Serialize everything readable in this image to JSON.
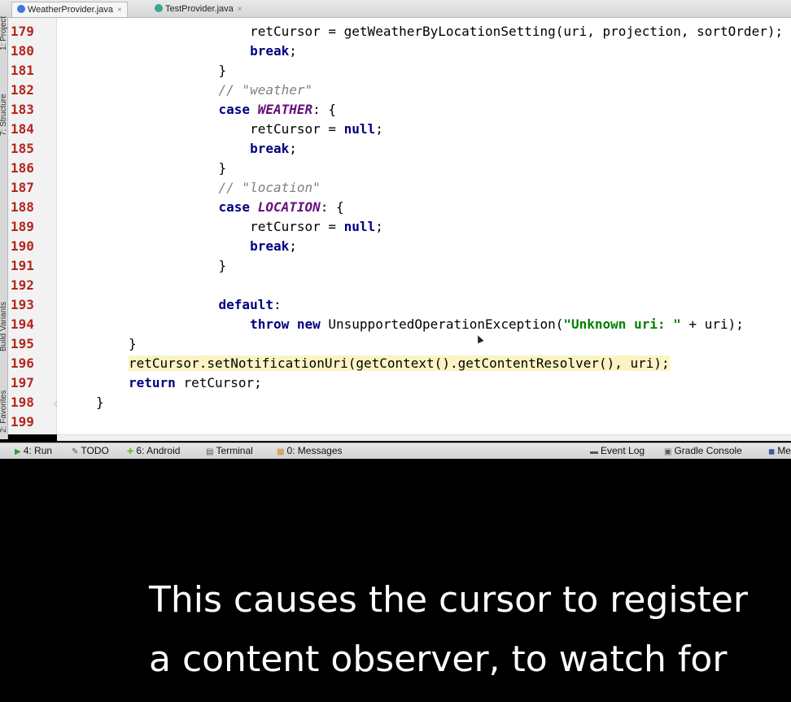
{
  "tabs": [
    {
      "label": "WeatherProvider.java",
      "close": "×",
      "color": "#3d7bd9"
    },
    {
      "label": "TestProvider.java",
      "close": "×",
      "color": "#3aa58f"
    }
  ],
  "left_strip": {
    "project": "1: Project",
    "structure": "7: Structure",
    "build_variants": "Build Variants",
    "favorites": "2: Favorites"
  },
  "editor": {
    "lines": [
      {
        "n": "179",
        "t": [
          {
            "c": "",
            "x": "        retCursor = getWeatherByLocationSetting(uri, projection, sortOrder);"
          }
        ]
      },
      {
        "n": "180",
        "t": [
          {
            "c": "",
            "x": "        "
          },
          {
            "c": "kw",
            "x": "break"
          },
          {
            "c": "",
            "x": ";"
          }
        ]
      },
      {
        "n": "181",
        "t": [
          {
            "c": "",
            "x": "    }"
          }
        ]
      },
      {
        "n": "182",
        "t": [
          {
            "c": "",
            "x": "    "
          },
          {
            "c": "cm",
            "x": "// \"weather\""
          }
        ]
      },
      {
        "n": "183",
        "t": [
          {
            "c": "",
            "x": "    "
          },
          {
            "c": "kw",
            "x": "case "
          },
          {
            "c": "const",
            "x": "WEATHER"
          },
          {
            "c": "",
            "x": ": {"
          }
        ]
      },
      {
        "n": "184",
        "t": [
          {
            "c": "",
            "x": "        retCursor = "
          },
          {
            "c": "kw",
            "x": "null"
          },
          {
            "c": "",
            "x": ";"
          }
        ]
      },
      {
        "n": "185",
        "t": [
          {
            "c": "",
            "x": "        "
          },
          {
            "c": "kw",
            "x": "break"
          },
          {
            "c": "",
            "x": ";"
          }
        ]
      },
      {
        "n": "186",
        "t": [
          {
            "c": "",
            "x": "    }"
          }
        ]
      },
      {
        "n": "187",
        "t": [
          {
            "c": "",
            "x": "    "
          },
          {
            "c": "cm",
            "x": "// \"location\""
          }
        ]
      },
      {
        "n": "188",
        "t": [
          {
            "c": "",
            "x": "    "
          },
          {
            "c": "kw",
            "x": "case "
          },
          {
            "c": "const",
            "x": "LOCATION"
          },
          {
            "c": "",
            "x": ": {"
          }
        ]
      },
      {
        "n": "189",
        "t": [
          {
            "c": "",
            "x": "        retCursor = "
          },
          {
            "c": "kw",
            "x": "null"
          },
          {
            "c": "",
            "x": ";"
          }
        ]
      },
      {
        "n": "190",
        "t": [
          {
            "c": "",
            "x": "        "
          },
          {
            "c": "kw",
            "x": "break"
          },
          {
            "c": "",
            "x": ";"
          }
        ]
      },
      {
        "n": "191",
        "t": [
          {
            "c": "",
            "x": "    }"
          }
        ]
      },
      {
        "n": "192",
        "t": [
          {
            "c": "",
            "x": ""
          }
        ]
      },
      {
        "n": "193",
        "t": [
          {
            "c": "",
            "x": "    "
          },
          {
            "c": "kw",
            "x": "default"
          },
          {
            "c": "",
            "x": ":"
          }
        ]
      },
      {
        "n": "194",
        "t": [
          {
            "c": "",
            "x": "        "
          },
          {
            "c": "kw",
            "x": "throw new "
          },
          {
            "c": "",
            "x": "UnsupportedOperationException("
          },
          {
            "c": "str",
            "x": "\"Unknown uri: \""
          },
          {
            "c": "",
            "x": " + uri);"
          }
        ]
      },
      {
        "n": "195",
        "t": [
          {
            "c": "",
            "x": "}"
          }
        ]
      },
      {
        "n": "196",
        "t": [
          {
            "c": "hl",
            "x": "retCursor.setNotificationUri(getContext().getContentResolver(), uri);"
          }
        ]
      },
      {
        "n": "197",
        "t": [
          {
            "c": "kw",
            "x": "return "
          },
          {
            "c": "",
            "x": "retCursor;"
          }
        ]
      },
      {
        "n": "198",
        "t": [
          {
            "c": "",
            "x": "}"
          }
        ]
      },
      {
        "n": "199",
        "t": [
          {
            "c": "",
            "x": ""
          }
        ]
      }
    ]
  },
  "toolbar": {
    "items": [
      {
        "label": "4: Run",
        "icon": "▶",
        "icon_name": "run-icon"
      },
      {
        "label": "TODO",
        "icon": "✎",
        "icon_name": "todo-icon"
      },
      {
        "label": "6: Android",
        "icon": "✚",
        "icon_name": "android-icon"
      },
      {
        "label": "Terminal",
        "icon": "▤",
        "icon_name": "terminal-icon"
      },
      {
        "label": "0: Messages",
        "icon": "▦",
        "icon_name": "messages-icon"
      },
      {
        "label": "Event Log",
        "icon": "▬",
        "icon_name": "event-log-icon"
      },
      {
        "label": "Gradle Console",
        "icon": "▣",
        "icon_name": "gradle-console-icon"
      },
      {
        "label": "Me",
        "icon": "◼",
        "icon_name": "maven-icon"
      }
    ]
  },
  "caption": {
    "line1": "This causes the cursor to register",
    "line2": "a content observer, to watch for"
  }
}
